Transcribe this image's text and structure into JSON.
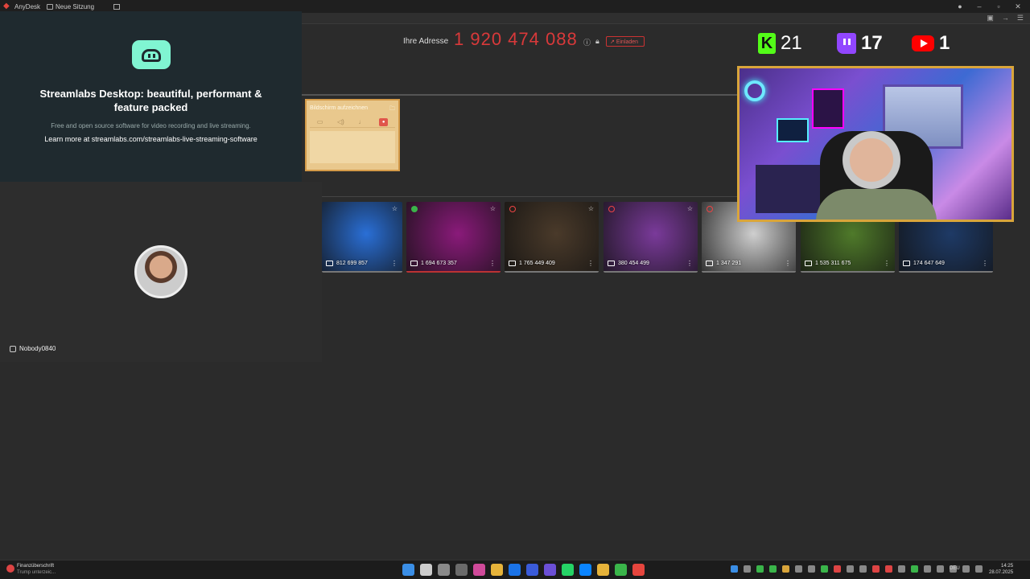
{
  "titlebar": {
    "app_name": "AnyDesk",
    "tab_label": "Neue Sitzung"
  },
  "streamlabs": {
    "title": "Streamlabs Desktop: beautiful, performant & feature packed",
    "subtitle": "Free and open source software for video recording and live streaming.",
    "link_text": "Learn more at streamlabs.com/streamlabs-live-streaming-software"
  },
  "user": {
    "name": "Nobody0840"
  },
  "address": {
    "label": "Ihre Adresse",
    "number": "1 920 474 088",
    "invite_label": "Einladen"
  },
  "recorder": {
    "title": "Bildschirm aufzeichnen"
  },
  "thumbnails": [
    {
      "id": "812 699 857",
      "status": "none",
      "bg": "#2a6fd6"
    },
    {
      "id": "1 694 673 357",
      "status": "ok",
      "bg": "#8a1a7a"
    },
    {
      "id": "1 765 449 409",
      "status": "blocked",
      "bg": "#4a3a2a"
    },
    {
      "id": "380 454 499",
      "status": "blocked",
      "bg": "#7a3a9a"
    },
    {
      "id": "1 347 291",
      "status": "blocked",
      "bg": "#cfcfcf"
    },
    {
      "id": "1 535 311 675",
      "status": "none",
      "bg": "#4f7a2a"
    },
    {
      "id": "174 647 649",
      "status": "none",
      "bg": "#1e3a66"
    }
  ],
  "counters": {
    "kick": "21",
    "twitch": "17",
    "youtube": "1"
  },
  "taskbar": {
    "weather_title": "Finanzüberschrift",
    "weather_sub": "Trump unterzeic...",
    "lang": "DEU",
    "time": "14:25",
    "date": "28.07.2025",
    "apps": [
      "#3a8ee6",
      "#cccccc",
      "#8a8a8a",
      "#6a6a6a",
      "#d04a9a",
      "#e6b33a",
      "#1a73e8",
      "#3a5bd9",
      "#6b4fd6",
      "#25d366",
      "#0a84ff",
      "#e6b33a",
      "#3ab54a",
      "#e5453d"
    ],
    "tray": [
      "#3a8ee6",
      "#888",
      "#3ab54a",
      "#3ab54a",
      "#d9a53b",
      "#888",
      "#888",
      "#3ab54a",
      "#d44",
      "#888",
      "#888",
      "#d44",
      "#d44",
      "#888",
      "#3ab54a",
      "#888",
      "#888",
      "#888",
      "#888",
      "#888"
    ]
  }
}
